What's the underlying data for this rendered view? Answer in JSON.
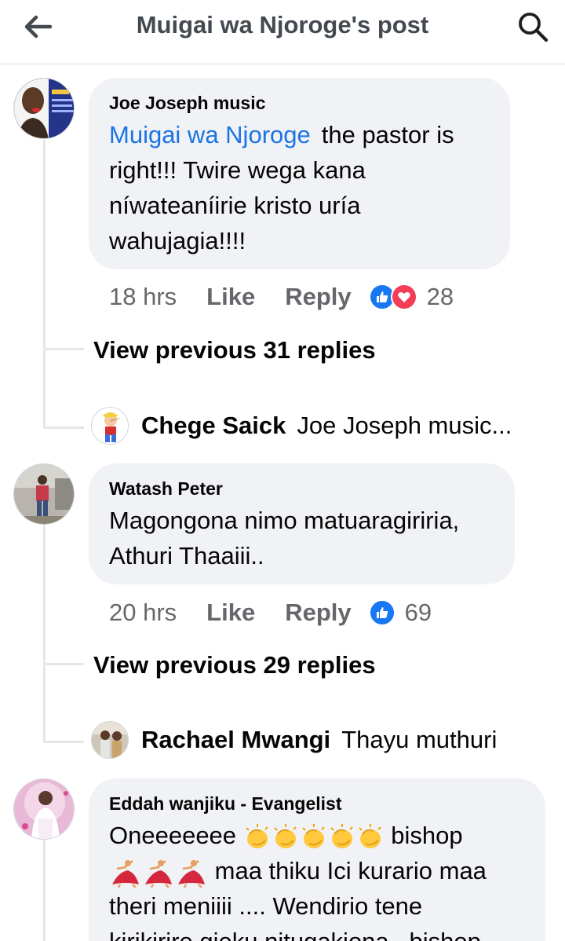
{
  "header": {
    "title": "Muigai wa Njoroge's post",
    "back_icon": "back-arrow-icon",
    "search_icon": "search-icon"
  },
  "comments": [
    {
      "author": "Joe Joseph music",
      "mention": "Muigai wa Njoroge",
      "text": "the pastor is right!!! Twire wega kana níwateaníirie kristo uría wahujagia!!!!",
      "time": "18 hrs",
      "like_label": "Like",
      "reply_label": "Reply",
      "reaction_count": "28",
      "reactions": [
        "like",
        "love"
      ],
      "view_previous": "View previous 31 replies",
      "latest_reply": {
        "author": "Chege Saick",
        "text": "Joe Joseph music..."
      }
    },
    {
      "author": "Watash Peter",
      "text": "Magongona nimo matuaragiriria, Athuri Thaaiii..",
      "time": "20 hrs",
      "like_label": "Like",
      "reply_label": "Reply",
      "reaction_count": "69",
      "reactions": [
        "like"
      ],
      "view_previous": "View previous 29 replies",
      "latest_reply": {
        "author": "Rachael Mwangi",
        "text": "Thayu muthuri"
      }
    },
    {
      "author": "Eddah wanjiku - Evangelist",
      "text_parts": {
        "line1_start": "Oneeeeeee",
        "line1_end": "bishop",
        "line2_end": "maa thiku Ici kurario maa",
        "line3": "theri meniiii .... Wendirio tene",
        "line4": "kirikirire gieku nitugakiona...bishop"
      },
      "emojis": [
        "clapping-hands",
        "dancer"
      ]
    }
  ],
  "colors": {
    "link": "#1b74e4",
    "bubble": "#f0f2f5",
    "like": "#1877f2",
    "love": "#f33e58",
    "secondary_text": "#65676b"
  }
}
